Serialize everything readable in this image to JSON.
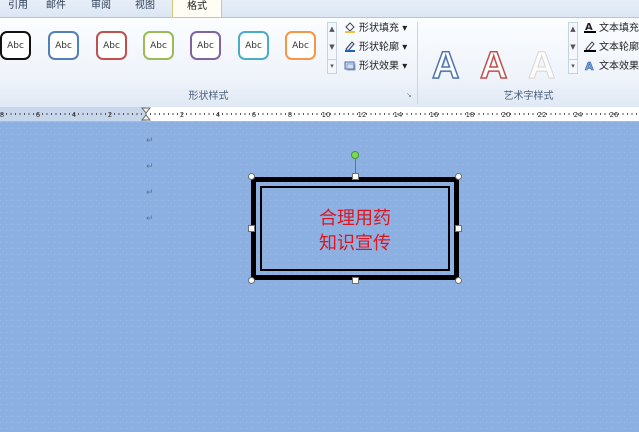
{
  "tabs": [
    {
      "label": "引用"
    },
    {
      "label": "邮件"
    },
    {
      "label": "审阅"
    },
    {
      "label": "视图"
    },
    {
      "label": "格式",
      "active": true
    }
  ],
  "ribbon": {
    "shape_styles": {
      "label": "形状样式",
      "swatch_text": "Abc",
      "swatch_colors": [
        "#000000",
        "#4f81bd",
        "#c0504d",
        "#9bbb59",
        "#8064a2",
        "#4bacc6",
        "#f79646"
      ],
      "fill_label": "形状填充",
      "outline_label": "形状轮廓",
      "effects_label": "形状效果"
    },
    "wordart_styles": {
      "label": "艺术字样式",
      "letter": "A",
      "text_fill_label": "文本填充",
      "text_outline_label": "文本轮廓",
      "text_effects_label": "文本效果"
    }
  },
  "ruler": {
    "labels": [
      "8",
      "6",
      "4",
      "2",
      "2",
      "4",
      "6",
      "8",
      "10",
      "12",
      "14",
      "16",
      "18",
      "20",
      "22",
      "24",
      "26",
      "28"
    ]
  },
  "document": {
    "paragraph_mark": "↵",
    "textbox": {
      "line1": "合理用药",
      "line2": "知识宣传"
    }
  }
}
